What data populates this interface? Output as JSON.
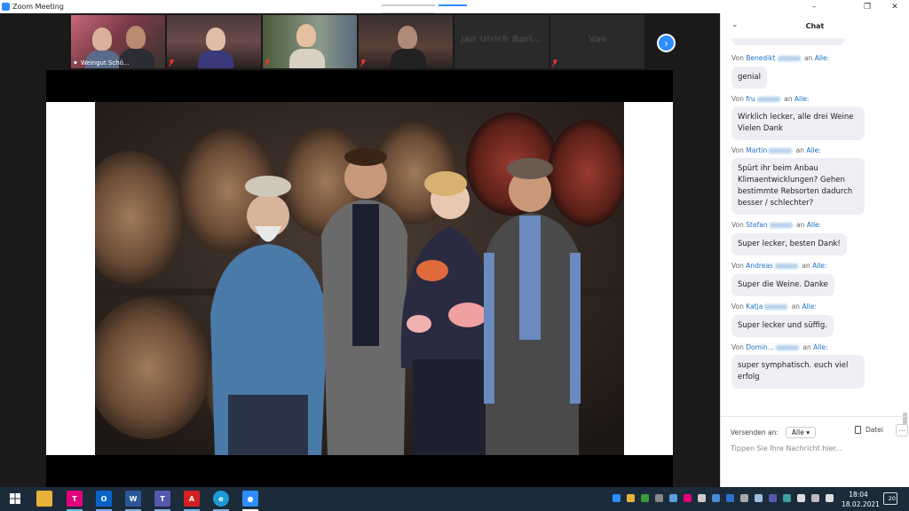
{
  "window": {
    "title": "Zoom Meeting"
  },
  "gallery": {
    "tiles": [
      {
        "name": "Weingut Schö...",
        "muted": false
      },
      {
        "name": "",
        "muted": true
      },
      {
        "name": "",
        "muted": true
      },
      {
        "name": "",
        "muted": true
      },
      {
        "name": "Jan Ulrich Barl...",
        "muted": false
      },
      {
        "name": "Vas",
        "muted": true
      }
    ],
    "next_icon": "chevron-right-icon"
  },
  "chat": {
    "title": "Chat",
    "messages": [
      {
        "prefix": "Von",
        "sender": "Benedikt",
        "to_word": "an",
        "to": "Alle:",
        "text": "genial"
      },
      {
        "prefix": "Von",
        "sender": "fru",
        "to_word": "an",
        "to": "Alle:",
        "text": "Wirklich lecker, alle drei Weine Vielen Dank"
      },
      {
        "prefix": "Von",
        "sender": "Martin",
        "to_word": "an",
        "to": "Alle:",
        "text": "Spürt ihr beim Anbau Klimaentwicklungen? Gehen bestimmte Rebsorten dadurch besser / schlechter?"
      },
      {
        "prefix": "Von",
        "sender": "Stefan",
        "to_word": "an",
        "to": "Alle:",
        "text": "Super lecker, besten Dank!"
      },
      {
        "prefix": "Von",
        "sender": "Andreas",
        "to_word": "an",
        "to": "Alle:",
        "text": "Super die Weine. Danke"
      },
      {
        "prefix": "Von",
        "sender": "Katja",
        "to_word": "an",
        "to": "Alle:",
        "text": "Super lecker und süffig."
      },
      {
        "prefix": "Von",
        "sender": "Domin...",
        "to_word": "an",
        "to": "Alle:",
        "text": "super symphatisch. euch viel erfolg"
      }
    ],
    "send_to_label": "Versenden an:",
    "send_to_value": "Alle",
    "file_label": "Datei",
    "more_label": "...",
    "input_placeholder": "Tippen Sie Ihre Nachricht hier..."
  },
  "taskbar": {
    "apps": [
      "windows-start-icon",
      "file-explorer-icon",
      "telekom-icon",
      "outlook-icon",
      "word-icon",
      "teams-icon",
      "acrobat-icon",
      "edge-icon",
      "zoom-icon"
    ],
    "time": "18:04",
    "date": "18.02.2021",
    "notifications": "20"
  },
  "colors": {
    "accent": "#2d8cff",
    "active_speaker": "#a6d13b",
    "chat_link": "#1a73c9",
    "taskbar": "#1c2b3a"
  }
}
